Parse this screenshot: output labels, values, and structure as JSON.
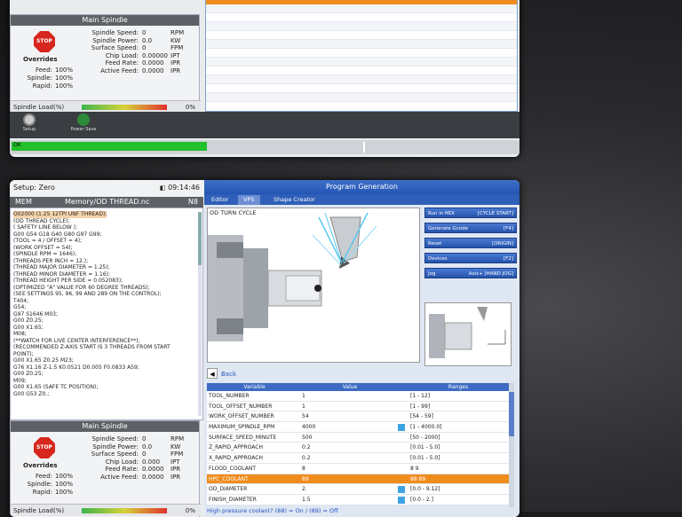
{
  "top_screen": {
    "spindle_panel": {
      "title": "Main Spindle",
      "stop_label": "STOP",
      "overrides_title": "Overrides",
      "overrides": [
        {
          "label": "Feed:",
          "value": "100%"
        },
        {
          "label": "Spindle:",
          "value": "100%"
        },
        {
          "label": "Rapid:",
          "value": "100%"
        }
      ],
      "readouts": [
        {
          "label": "Spindle Speed:",
          "value": "0",
          "unit": "RPM"
        },
        {
          "label": "Spindle Power:",
          "value": "0.0",
          "unit": "KW"
        },
        {
          "label": "Surface Speed:",
          "value": "0",
          "unit": "FPM"
        },
        {
          "label": "Chip Load:",
          "value": "0.00000",
          "unit": "IPT"
        },
        {
          "label": "Feed Rate:",
          "value": "0.0000",
          "unit": "IPR"
        },
        {
          "label": "Active Feed:",
          "value": "0.0000",
          "unit": "IPR"
        }
      ],
      "load_label": "Spindle Load(%)",
      "load_value": "0%",
      "load_fraction": 0.0
    },
    "dock": [
      {
        "label": "Setup",
        "icon": "lock-icon"
      },
      {
        "label": "Power Save",
        "icon": "tree-icon"
      }
    ],
    "status_text": "OK"
  },
  "bottom_screen": {
    "setup_label": "Setup: Zero",
    "time": "09:14:46",
    "mem_label": "MEM",
    "file_label": "Memory/OD THREAD.nc",
    "block_label": "N8",
    "program_lines": [
      "O02000 (1.25 12TPI UNF THREAD);",
      "(OD THREAD CYCLE);",
      "( SAFETY LINE BELOW );",
      "G00 G54 G18 G40 G80 G97 G99;",
      "(TOOL = 4 / OFFSET = 4);",
      "(WORK OFFSET = 54);",
      "(SPINDLE RPM = 1646);",
      "(THREADS PER INCH = 12.);",
      "(THREAD MAJOR DIAMETER = 1.25);",
      "(THREAD MINOR DIAMETER = 1.16);",
      "(THREAD HEIGHT PER SIDE = 0.052083);",
      "(OPTIMIZED \"A\" VALUE FOR 60 DEGREE THREADS);",
      "(SEE SETTINGS 95, 96, 99 AND 289 ON THE CONTROL);",
      "T404;",
      "G54;",
      "G97 S1646 M03;",
      "G00 Z0.25;",
      "G00 X1.65;",
      "M08;",
      "(**WATCH FOR LIVE CENTER INTERFERENCE**);",
      "(RECOMMENDED Z-AXIS START IS 3 THREADS FROM START",
      "POINT);",
      "G00 X1.65 Z0.25 M23;",
      "G76 X1.16 Z-1.5 K0.0521 D0.005 F0.0833 A59;",
      "G00 Z0.25;",
      "M09;",
      "G00 X1.65 (SAFE TC POSITION);",
      "G00 G53 Z0.;"
    ],
    "spindle_panel": {
      "title": "Main Spindle",
      "stop_label": "STOP",
      "overrides_title": "Overrides",
      "overrides": [
        {
          "label": "Feed:",
          "value": "100%"
        },
        {
          "label": "Spindle:",
          "value": "100%"
        },
        {
          "label": "Rapid:",
          "value": "100%"
        }
      ],
      "readouts": [
        {
          "label": "Spindle Speed:",
          "value": "0",
          "unit": "RPM"
        },
        {
          "label": "Spindle Power:",
          "value": "0.0",
          "unit": "KW"
        },
        {
          "label": "Surface Speed:",
          "value": "0",
          "unit": "FPM"
        },
        {
          "label": "Chip Load:",
          "value": "0.000",
          "unit": "IPT"
        },
        {
          "label": "Feed Rate:",
          "value": "0.0000",
          "unit": "IPR"
        },
        {
          "label": "Active Feed:",
          "value": "0.0000",
          "unit": "IPR"
        }
      ],
      "load_label": "Spindle Load(%)",
      "load_value": "0%",
      "load_fraction": 0.0
    },
    "program_generation": {
      "title": "Program Generation",
      "tabs": [
        "Editor",
        "VPS",
        "Shape Creator"
      ],
      "active_tab": "VPS",
      "canvas_caption": "OD TURN CYCLE",
      "buttons": [
        {
          "label": "Run in MDI",
          "key": "[CYCLE START]"
        },
        {
          "label": "Generate Gcode",
          "key": "[F4]"
        },
        {
          "label": "Reset",
          "key": "[ORIGIN]"
        },
        {
          "label": "Devices",
          "key": "[F2]"
        },
        {
          "label": "Jog",
          "key": "Axis+ [HAND JOG]"
        }
      ],
      "back_label": "Back",
      "table_headers": [
        "Variable",
        "Value",
        "Ranges"
      ],
      "rows": [
        {
          "name": "TOOL_NUMBER",
          "value": "1",
          "range": "[1 - 12]",
          "flag": false
        },
        {
          "name": "TOOL_OFFSET_NUMBER",
          "value": "1",
          "range": "[1 - 99]",
          "flag": false
        },
        {
          "name": "WORK_OFFSET_NUMBER",
          "value": "54",
          "range": "[54 - 59]",
          "flag": false
        },
        {
          "name": "MAXIMUM_SPINDLE_RPM",
          "value": "4000",
          "range": "[1 - 4000.0]",
          "flag": true
        },
        {
          "name": "SURFACE_SPEED_MINUTE",
          "value": "500",
          "range": "[50 - 2000]",
          "flag": false
        },
        {
          "name": "Z_RAPID_APPROACH",
          "value": "0.2",
          "range": "[0.01 - 5.0]",
          "flag": false
        },
        {
          "name": "X_RAPID_APPROACH",
          "value": "0.2",
          "range": "[0.01 - 5.0]",
          "flag": false
        },
        {
          "name": "FLOOD_COOLANT",
          "value": "8",
          "range": "8 9",
          "flag": false
        },
        {
          "name": "HPC_COOLANT",
          "value": "89",
          "range": "88 89",
          "flag": false
        },
        {
          "name": "OD_DIAMETER",
          "value": "2.",
          "range": "[0.0 - 9.12]",
          "flag": true
        },
        {
          "name": "FINISH_DIAMETER",
          "value": "1.5",
          "range": "[0.0 - 2.]",
          "flag": true
        }
      ],
      "selected_row": 8,
      "hint": "High pressure coolant? (88) = On / (89) = Off"
    }
  }
}
